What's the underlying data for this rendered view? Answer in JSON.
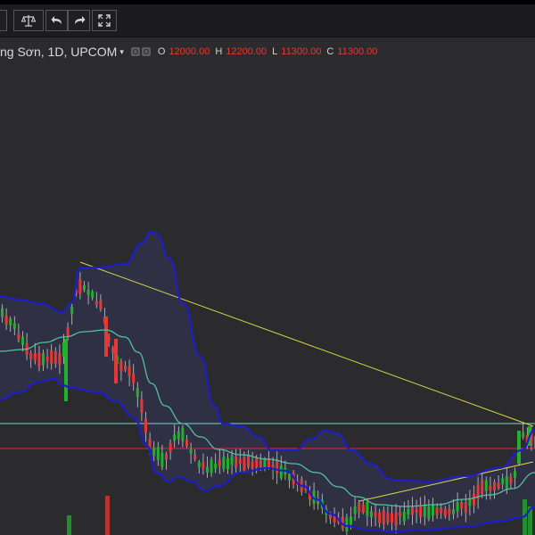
{
  "toolbar": {
    "scale_icon": "scales-icon",
    "undo_icon": "undo-arrow-icon",
    "redo_icon": "redo-arrow-icon",
    "fullscreen_icon": "fullscreen-icon"
  },
  "legend": {
    "symbol": "ng Sơn, 1D, UPCOM",
    "caret": "▾",
    "o_label": "O",
    "o_value": "12000.00",
    "h_label": "H",
    "h_value": "12200.00",
    "l_label": "L",
    "l_value": "11300.00",
    "c_label": "C",
    "c_value": "11300.00"
  },
  "colors": {
    "background": "#2b2b2e",
    "up_candle": "#22b02e",
    "down_candle": "#e53935",
    "band": "#1e1ec8",
    "middle_band": "#4fc3a1",
    "trendline": "#d9d94a",
    "horizontal_support": "#7ad3d3",
    "horizontal_price": "#d32f2f"
  }
}
